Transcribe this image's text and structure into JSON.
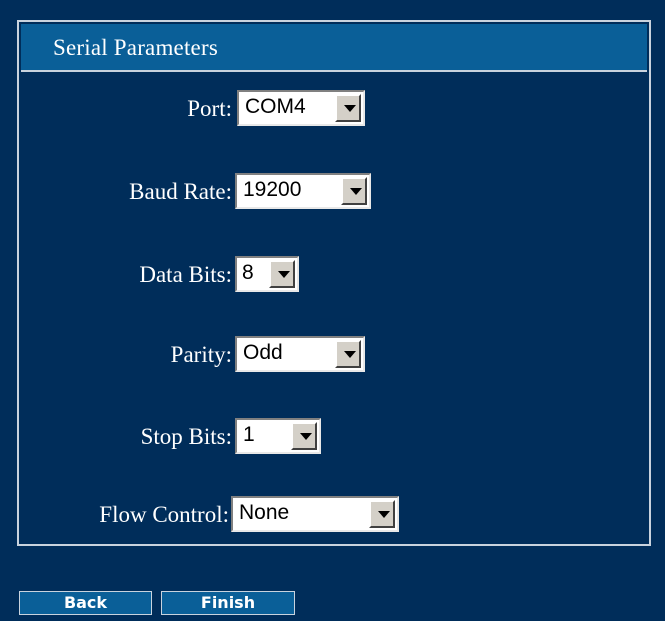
{
  "panel": {
    "title": "Serial Parameters"
  },
  "fields": {
    "port": {
      "label": "Port:",
      "value": "COM4"
    },
    "baud_rate": {
      "label": "Baud Rate:",
      "value": "19200"
    },
    "data_bits": {
      "label": "Data Bits:",
      "value": "8"
    },
    "parity": {
      "label": "Parity:",
      "value": "Odd"
    },
    "stop_bits": {
      "label": "Stop Bits:",
      "value": "1"
    },
    "flow_control": {
      "label": "Flow Control:",
      "value": "None"
    }
  },
  "buttons": {
    "back": "Back",
    "finish": "Finish"
  },
  "icons": {
    "dropdown": "chevron-down-icon"
  },
  "colors": {
    "background": "#002d5a",
    "header": "#0a5f98",
    "border": "#c9d3de"
  }
}
